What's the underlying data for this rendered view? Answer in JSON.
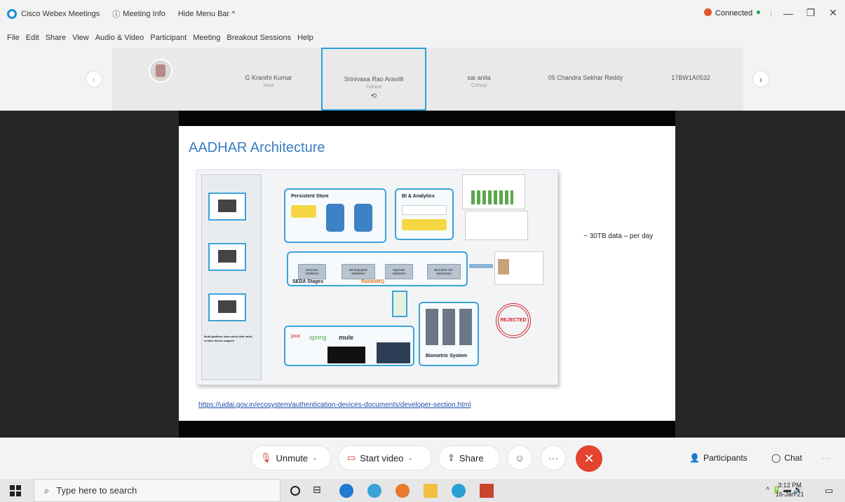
{
  "titlebar": {
    "app": "Cisco Webex Meetings",
    "meeting_info": "Meeting Info",
    "hide_menu": "Hide Menu Bar ^",
    "status": "Connected"
  },
  "menu": [
    "File",
    "Edit",
    "Share",
    "View",
    "Audio & Video",
    "Participant",
    "Meeting",
    "Breakout Sessions",
    "Help"
  ],
  "participants": [
    {
      "name": "G Kranthi Kumar",
      "role": "Host"
    },
    {
      "name": "Srinivasa Rao Aravilli",
      "role": "Cohost"
    },
    {
      "name": "sai anila",
      "role": "Cohost"
    },
    {
      "name": "05 Chandra Sekhar Reddy",
      "role": ""
    },
    {
      "name": "17BW1A0532",
      "role": ""
    }
  ],
  "slide": {
    "title": "AADHAR Architecture",
    "note": "~ 30TB data – per day",
    "link": "https://uidai.gov.in/ecosystem/authentication-devices-documents/developer-section.html",
    "diagram": {
      "persistent_store": "Persistent Store",
      "bi_analytics": "BI & Analytics",
      "seda": "SEDA Stages",
      "rabbitmq": "RabbitMQ",
      "biometric": "Biometric System",
      "multi_platform": "Multi-platform Java client with multi-vendor device support",
      "rejected": "REJECTED",
      "stages": [
        "Structure Validation",
        "Demographic Validation",
        "Operator Validation",
        "Biometric De-duplication"
      ],
      "tech": [
        "java",
        "spring",
        "mule"
      ]
    }
  },
  "controls": {
    "unmute": "Unmute",
    "start_video": "Start video",
    "share": "Share",
    "more": "···",
    "participants": "Participants",
    "chat": "Chat"
  },
  "taskbar": {
    "search": "Type here to search",
    "time": "3:12 PM",
    "date": "16-Jan-21"
  },
  "colors": {
    "accent": "#2a9fd6",
    "end_call": "#e4432d",
    "slide_title": "#3a7cc2"
  }
}
